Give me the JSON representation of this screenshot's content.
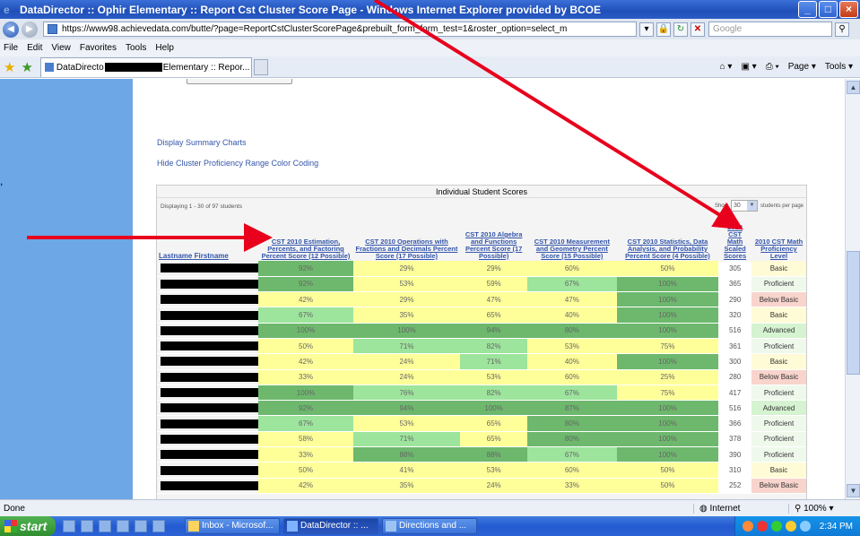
{
  "window": {
    "title": "DataDirector :: Ophir Elementary :: Report Cst Cluster Score Page - Windows Internet Explorer provided by BCOE"
  },
  "address": {
    "url": "https://www98.achievedata.com/butte/?page=ReportCstClusterScorePage&prebuilt_form_form_test=1&roster_option=select_m",
    "search_placeholder": "Google"
  },
  "menu": [
    "File",
    "Edit",
    "View",
    "Favorites",
    "Tools",
    "Help"
  ],
  "tab": {
    "label_prefix": "DataDirecto",
    "label_suffix": "Elementary :: Repor..."
  },
  "cmdbar": {
    "page": "Page ▾",
    "tools": "Tools ▾"
  },
  "links": {
    "summary_charts": "Display Summary Charts",
    "hide_color": "Hide Cluster Proficiency Range Color Coding"
  },
  "table": {
    "title": "Individual Student Scores",
    "displaying": "Displaying 1 - 30 of 97 students",
    "show_label": "Show",
    "per_page_value": "30",
    "per_page_label": "students per page",
    "headers": {
      "lastname": "Lastname",
      "firstname": "Firstname",
      "c1": "CST 2010 Estimation, Percents, and Factoring Percent Score (12 Possible)",
      "c2": "CST 2010 Operations with Fractions and Decimals Percent Score (17 Possible)",
      "c3": "CST 2010 Algebra and Functions Percent Score (17 Possible)",
      "c4": "CST 2010 Measurement and Geometry Percent Score (15 Possible)",
      "c5": "CST 2010 Statistics, Data Analysis, and Probability Percent Score (4 Possible)",
      "c6": "2010 CST Math Scaled Scores",
      "c7": "2010 CST Math Proficiency Level"
    },
    "rows": [
      {
        "s": [
          "92%",
          "29%",
          "29%",
          "60%",
          "50%"
        ],
        "c": [
          "dg",
          "y",
          "y",
          "y",
          "y"
        ],
        "scaled": "305",
        "level": "Basic",
        "lv": "basic"
      },
      {
        "s": [
          "92%",
          "53%",
          "59%",
          "67%",
          "100%"
        ],
        "c": [
          "dg",
          "y",
          "y",
          "lg",
          "dg"
        ],
        "scaled": "365",
        "level": "Proficient",
        "lv": "prof"
      },
      {
        "s": [
          "42%",
          "29%",
          "47%",
          "47%",
          "100%"
        ],
        "c": [
          "y",
          "y",
          "y",
          "y",
          "dg"
        ],
        "scaled": "290",
        "level": "Below Basic",
        "lv": "below"
      },
      {
        "s": [
          "67%",
          "35%",
          "65%",
          "40%",
          "100%"
        ],
        "c": [
          "lg",
          "y",
          "y",
          "y",
          "dg"
        ],
        "scaled": "320",
        "level": "Basic",
        "lv": "basic"
      },
      {
        "s": [
          "100%",
          "100%",
          "94%",
          "80%",
          "100%"
        ],
        "c": [
          "dg",
          "dg",
          "dg",
          "dg",
          "dg"
        ],
        "scaled": "516",
        "level": "Advanced",
        "lv": "adv"
      },
      {
        "s": [
          "50%",
          "71%",
          "82%",
          "53%",
          "75%"
        ],
        "c": [
          "y",
          "lg",
          "lg",
          "y",
          "y"
        ],
        "scaled": "361",
        "level": "Proficient",
        "lv": "prof"
      },
      {
        "s": [
          "42%",
          "24%",
          "71%",
          "40%",
          "100%"
        ],
        "c": [
          "y",
          "y",
          "lg",
          "y",
          "dg"
        ],
        "scaled": "300",
        "level": "Basic",
        "lv": "basic"
      },
      {
        "s": [
          "33%",
          "24%",
          "53%",
          "60%",
          "25%"
        ],
        "c": [
          "y",
          "y",
          "y",
          "y",
          "y"
        ],
        "scaled": "280",
        "level": "Below Basic",
        "lv": "below"
      },
      {
        "s": [
          "100%",
          "76%",
          "82%",
          "67%",
          "75%"
        ],
        "c": [
          "dg",
          "lg",
          "lg",
          "lg",
          "y"
        ],
        "scaled": "417",
        "level": "Proficient",
        "lv": "prof"
      },
      {
        "s": [
          "92%",
          "94%",
          "100%",
          "87%",
          "100%"
        ],
        "c": [
          "dg",
          "dg",
          "dg",
          "dg",
          "dg"
        ],
        "scaled": "516",
        "level": "Advanced",
        "lv": "adv"
      },
      {
        "s": [
          "67%",
          "53%",
          "65%",
          "80%",
          "100%"
        ],
        "c": [
          "lg",
          "y",
          "y",
          "dg",
          "dg"
        ],
        "scaled": "366",
        "level": "Proficient",
        "lv": "prof"
      },
      {
        "s": [
          "58%",
          "71%",
          "65%",
          "80%",
          "100%"
        ],
        "c": [
          "y",
          "lg",
          "y",
          "dg",
          "dg"
        ],
        "scaled": "378",
        "level": "Proficient",
        "lv": "prof"
      },
      {
        "s": [
          "33%",
          "88%",
          "88%",
          "67%",
          "100%"
        ],
        "c": [
          "y",
          "dg",
          "dg",
          "lg",
          "dg"
        ],
        "scaled": "390",
        "level": "Proficient",
        "lv": "prof"
      },
      {
        "s": [
          "50%",
          "41%",
          "53%",
          "60%",
          "50%"
        ],
        "c": [
          "y",
          "y",
          "y",
          "y",
          "y"
        ],
        "scaled": "310",
        "level": "Basic",
        "lv": "basic"
      },
      {
        "s": [
          "42%",
          "35%",
          "24%",
          "33%",
          "50%"
        ],
        "c": [
          "y",
          "y",
          "y",
          "y",
          "y"
        ],
        "scaled": "252",
        "level": "Below Basic",
        "lv": "below"
      }
    ]
  },
  "status": {
    "done": "Done",
    "zone": "Internet",
    "zoom": "100%"
  },
  "taskbar": {
    "start": "start",
    "items": [
      "Inbox - Microsof...",
      "DataDirector :: ...",
      "Directions and ..."
    ],
    "clock": "2:34 PM"
  },
  "colors": {
    "dg": "#6db86d",
    "lg": "#9de49d",
    "y": "#ffff99",
    "annotation_arrow": "#e8001c"
  }
}
